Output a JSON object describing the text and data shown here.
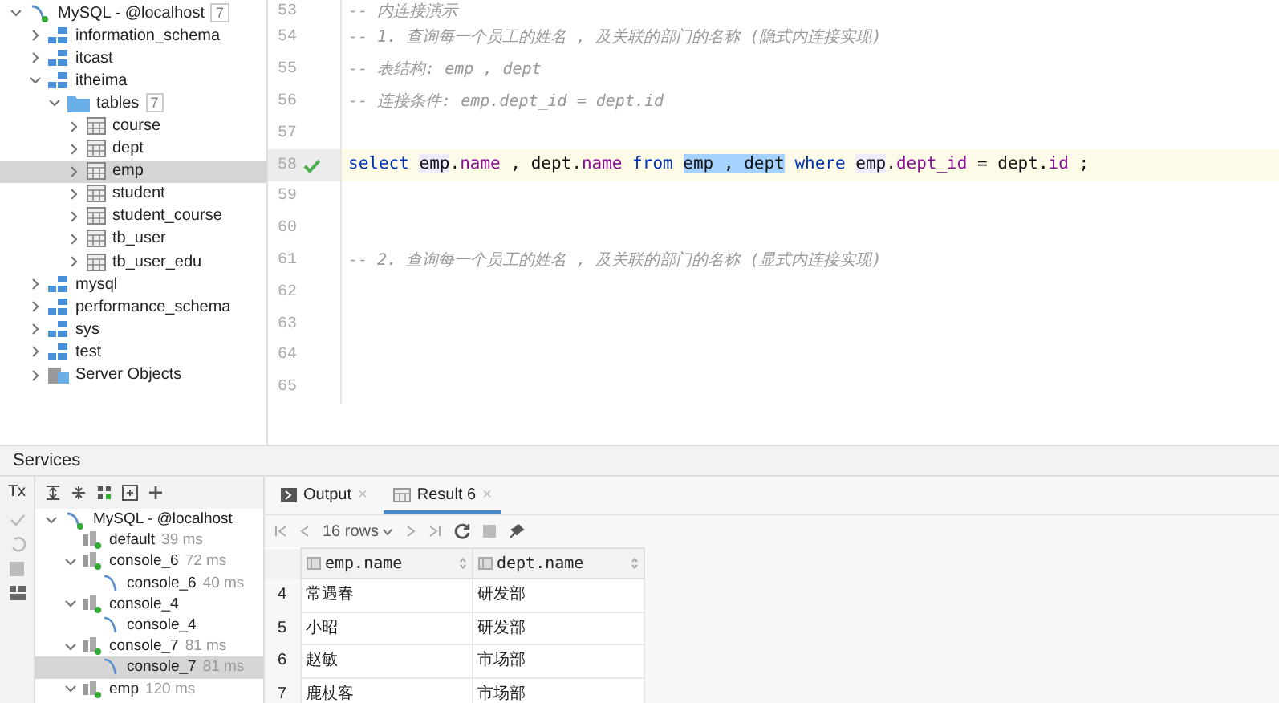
{
  "db_tree": [
    {
      "label": "MySQL - @localhost",
      "kind": "connection",
      "expanded": true,
      "selected": false,
      "badge": "7",
      "children": [
        {
          "label": "information_schema",
          "kind": "schema",
          "expanded": false,
          "selected": false
        },
        {
          "label": "itcast",
          "kind": "schema",
          "expanded": false,
          "selected": false
        },
        {
          "label": "itheima",
          "kind": "schema",
          "expanded": true,
          "selected": false,
          "children": [
            {
              "label": "tables",
              "kind": "folder",
              "expanded": true,
              "selected": false,
              "badge": "7",
              "children": [
                {
                  "label": "course",
                  "kind": "table",
                  "expanded": false,
                  "selected": false
                },
                {
                  "label": "dept",
                  "kind": "table",
                  "expanded": false,
                  "selected": false
                },
                {
                  "label": "emp",
                  "kind": "table",
                  "expanded": false,
                  "selected": true
                },
                {
                  "label": "student",
                  "kind": "table",
                  "expanded": false,
                  "selected": false
                },
                {
                  "label": "student_course",
                  "kind": "table",
                  "expanded": false,
                  "selected": false
                },
                {
                  "label": "tb_user",
                  "kind": "table",
                  "expanded": false,
                  "selected": false
                },
                {
                  "label": "tb_user_edu",
                  "kind": "table",
                  "expanded": false,
                  "selected": false
                }
              ]
            }
          ]
        },
        {
          "label": "mysql",
          "kind": "schema",
          "expanded": false,
          "selected": false
        },
        {
          "label": "performance_schema",
          "kind": "schema",
          "expanded": false,
          "selected": false
        },
        {
          "label": "sys",
          "kind": "schema",
          "expanded": false,
          "selected": false
        },
        {
          "label": "test",
          "kind": "schema",
          "expanded": false,
          "selected": false
        },
        {
          "label": "Server Objects",
          "kind": "server",
          "expanded": false,
          "selected": false
        }
      ]
    }
  ],
  "editor": {
    "lines": [
      {
        "number": "53",
        "kind": "comment",
        "text": "-- 内连接演示",
        "current": false,
        "checked": false
      },
      {
        "number": "54",
        "kind": "comment",
        "text": "-- 1. 查询每一个员工的姓名 , 及关联的部门的名称 (隐式内连接实现)",
        "current": false,
        "checked": false
      },
      {
        "number": "55",
        "kind": "comment",
        "text": "-- 表结构: emp , dept",
        "current": false,
        "checked": false
      },
      {
        "number": "56",
        "kind": "comment",
        "text": "-- 连接条件: emp.dept_id = dept.id",
        "current": false,
        "checked": false
      },
      {
        "number": "57",
        "kind": "blank",
        "current": false,
        "checked": false
      },
      {
        "number": "58",
        "kind": "code",
        "current": true,
        "checked": true,
        "tokens": [
          {
            "text": "select ",
            "kind": "keyword",
            "selected": false
          },
          {
            "text": "emp",
            "kind": "alias",
            "selected": false
          },
          {
            "text": ".",
            "kind": "plain",
            "selected": false
          },
          {
            "text": "name",
            "kind": "field",
            "selected": false
          },
          {
            "text": " , dept.",
            "kind": "plain",
            "selected": false
          },
          {
            "text": "name ",
            "kind": "field",
            "selected": false
          },
          {
            "text": "from ",
            "kind": "keyword",
            "selected": false
          },
          {
            "text": "emp , dept",
            "kind": "plain",
            "selected": true
          },
          {
            "text": " where ",
            "kind": "keyword",
            "selected": false
          },
          {
            "text": "emp",
            "kind": "alias",
            "selected": false
          },
          {
            "text": ".",
            "kind": "plain",
            "selected": false
          },
          {
            "text": "dept_id",
            "kind": "field",
            "selected": false
          },
          {
            "text": " = dept.",
            "kind": "plain",
            "selected": false
          },
          {
            "text": "id",
            "kind": "field",
            "selected": false
          },
          {
            "text": " ;",
            "kind": "plain",
            "selected": false
          }
        ]
      },
      {
        "number": "59",
        "kind": "blank",
        "current": false,
        "checked": false
      },
      {
        "number": "60",
        "kind": "blank",
        "current": false,
        "checked": false
      },
      {
        "number": "61",
        "kind": "comment",
        "text": "-- 2. 查询每一个员工的姓名 , 及关联的部门的名称 (显式内连接实现)",
        "current": false,
        "checked": false
      },
      {
        "number": "62",
        "kind": "blank",
        "current": false,
        "checked": false
      },
      {
        "number": "63",
        "kind": "blank",
        "current": false,
        "checked": false
      },
      {
        "number": "64",
        "kind": "blank",
        "current": false,
        "checked": false
      },
      {
        "number": "65",
        "kind": "blank",
        "current": false,
        "checked": false
      }
    ]
  },
  "services": {
    "title": "Services",
    "side_toolbar": {
      "tx": "Tx"
    },
    "tree": [
      {
        "label": "MySQL - @localhost",
        "kind": "connection",
        "expanded": true,
        "selected": false,
        "children": [
          {
            "label": "default",
            "time": "39 ms",
            "kind": "session",
            "selected": false
          },
          {
            "label": "console_6",
            "time": "72 ms",
            "kind": "session",
            "expanded": true,
            "selected": false,
            "children": [
              {
                "label": "console_6",
                "time": "40 ms",
                "kind": "console",
                "selected": false
              }
            ]
          },
          {
            "label": "console_4",
            "kind": "session",
            "expanded": true,
            "selected": false,
            "children": [
              {
                "label": "console_4",
                "kind": "console",
                "selected": false
              }
            ]
          },
          {
            "label": "console_7",
            "time": "81 ms",
            "kind": "session",
            "expanded": true,
            "selected": false,
            "children": [
              {
                "label": "console_7",
                "time": "81 ms",
                "kind": "console",
                "selected": true
              }
            ]
          },
          {
            "label": "emp",
            "time": "120 ms",
            "kind": "session",
            "expanded": true,
            "selected": false
          }
        ]
      }
    ]
  },
  "results": {
    "tabs": [
      {
        "label": "Output",
        "kind": "output",
        "close": "×",
        "selected": false
      },
      {
        "label": "Result 6",
        "kind": "grid",
        "close": "×",
        "selected": true
      }
    ],
    "rows_selector": "16 rows",
    "table": {
      "columns": [
        "emp.name",
        "dept.name"
      ],
      "rows": [
        {
          "index": "4",
          "cells": [
            "常遇春",
            "研发部"
          ]
        },
        {
          "index": "5",
          "cells": [
            "小昭",
            "研发部"
          ]
        },
        {
          "index": "6",
          "cells": [
            "赵敏",
            "市场部"
          ]
        },
        {
          "index": "7",
          "cells": [
            "鹿杖客",
            "市场部"
          ]
        }
      ]
    }
  }
}
